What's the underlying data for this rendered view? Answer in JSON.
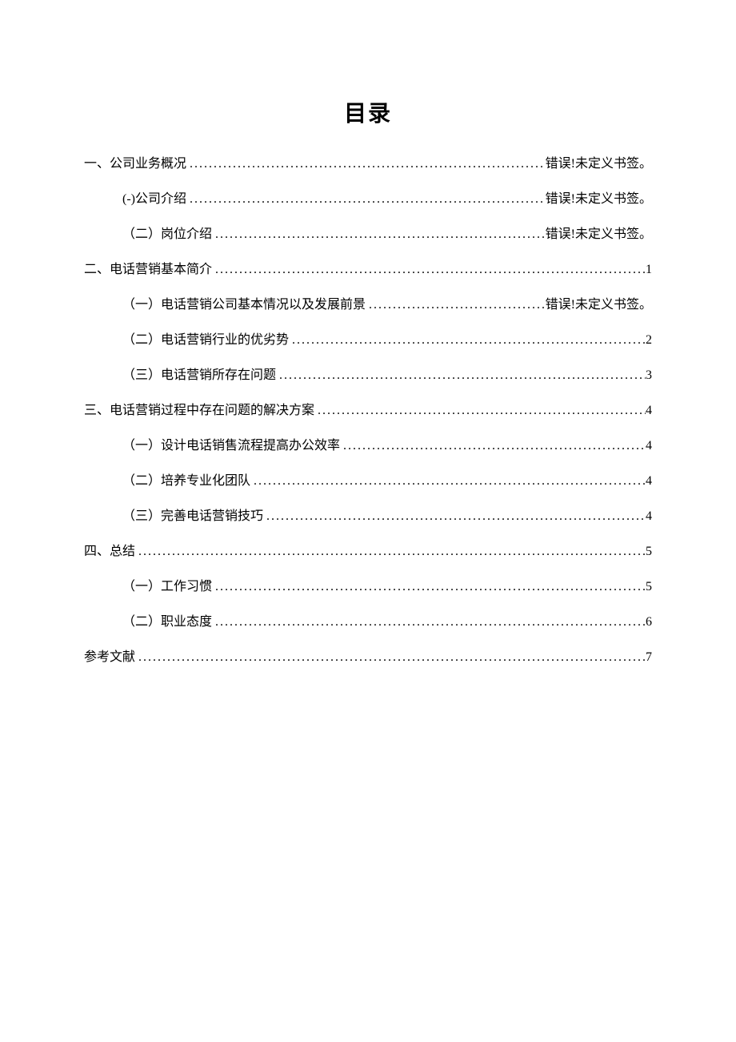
{
  "title": "目录",
  "entries": [
    {
      "level": 1,
      "label": "一、公司业务概况",
      "page": "错误!未定义书签。"
    },
    {
      "level": 2,
      "label": "(-)公司介绍",
      "page": "错误!未定义书签。"
    },
    {
      "level": 2,
      "label": "（二）岗位介绍",
      "page": "错误!未定义书签。"
    },
    {
      "level": 1,
      "label": "二、电话营销基本简介",
      "page": "1"
    },
    {
      "level": 2,
      "label": "（一）电话营销公司基本情况以及发展前景",
      "page": "错误!未定义书签。"
    },
    {
      "level": 2,
      "label": "（二）电话营销行业的优劣势",
      "page": "2"
    },
    {
      "level": 2,
      "label": "（三）电话营销所存在问题",
      "page": "3"
    },
    {
      "level": 1,
      "label": "三、电话营销过程中存在问题的解决方案",
      "page": "4"
    },
    {
      "level": 2,
      "label": "（一）设计电话销售流程提高办公效率",
      "page": "4"
    },
    {
      "level": 2,
      "label": "（二）培养专业化团队",
      "page": "4"
    },
    {
      "level": 2,
      "label": "（三）完善电话营销技巧",
      "page": "4"
    },
    {
      "level": 1,
      "label": "四、总结",
      "page": "5"
    },
    {
      "level": 2,
      "label": "（一）工作习惯",
      "page": "5"
    },
    {
      "level": 2,
      "label": "（二）职业态度",
      "page": "6"
    },
    {
      "level": 1,
      "label": "参考文献",
      "page": "7"
    }
  ]
}
